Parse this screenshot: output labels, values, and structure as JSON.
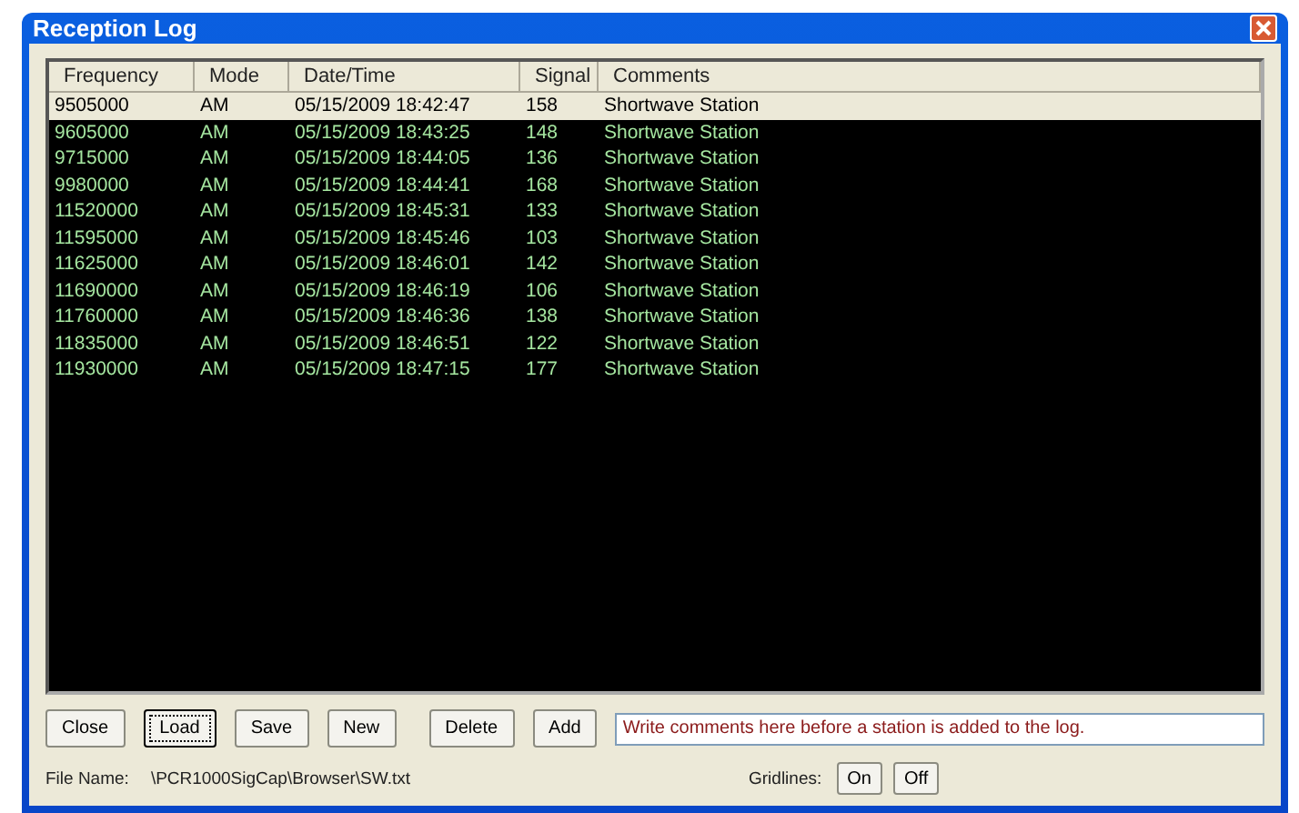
{
  "window": {
    "title": "Reception Log"
  },
  "table": {
    "columns": [
      "Frequency",
      "Mode",
      "Date/Time",
      "Signal",
      "Comments"
    ],
    "rows": [
      {
        "cells": [
          "9505000",
          "AM",
          "05/15/2009 18:42:47",
          "158",
          "Shortwave Station"
        ],
        "selected": true
      },
      {
        "cells": [
          "9605000",
          "AM",
          "05/15/2009 18:43:25",
          "148",
          "Shortwave Station"
        ],
        "selected": false
      },
      {
        "cells": [
          "9715000",
          "AM",
          "05/15/2009 18:44:05",
          "136",
          "Shortwave Station"
        ],
        "selected": false
      },
      {
        "cells": [
          "9980000",
          "AM",
          "05/15/2009 18:44:41",
          "168",
          "Shortwave Station"
        ],
        "selected": false
      },
      {
        "cells": [
          "11520000",
          "AM",
          "05/15/2009 18:45:31",
          "133",
          "Shortwave Station"
        ],
        "selected": false
      },
      {
        "cells": [
          "11595000",
          "AM",
          "05/15/2009 18:45:46",
          "103",
          "Shortwave Station"
        ],
        "selected": false
      },
      {
        "cells": [
          "11625000",
          "AM",
          "05/15/2009 18:46:01",
          "142",
          "Shortwave Station"
        ],
        "selected": false
      },
      {
        "cells": [
          "11690000",
          "AM",
          "05/15/2009 18:46:19",
          "106",
          "Shortwave Station"
        ],
        "selected": false
      },
      {
        "cells": [
          "11760000",
          "AM",
          "05/15/2009 18:46:36",
          "138",
          "Shortwave Station"
        ],
        "selected": false
      },
      {
        "cells": [
          "11835000",
          "AM",
          "05/15/2009 18:46:51",
          "122",
          "Shortwave Station"
        ],
        "selected": false
      },
      {
        "cells": [
          "11930000",
          "AM",
          "05/15/2009 18:47:15",
          "177",
          "Shortwave Station"
        ],
        "selected": false
      }
    ]
  },
  "buttons": [
    {
      "label": "Close",
      "focused": false
    },
    {
      "label": "Load",
      "focused": true
    },
    {
      "label": "Save",
      "focused": false
    },
    {
      "label": "New",
      "focused": false
    },
    {
      "label": "Delete",
      "focused": false
    },
    {
      "label": "Add",
      "focused": false
    }
  ],
  "comment_field": {
    "value": "Write comments here before a station is added to the log."
  },
  "file_name": {
    "label": "File Name:",
    "value": "\\PCR1000SigCap\\Browser\\SW.txt"
  },
  "gridlines": {
    "label": "Gridlines:",
    "buttons": [
      "On",
      "Off"
    ]
  }
}
